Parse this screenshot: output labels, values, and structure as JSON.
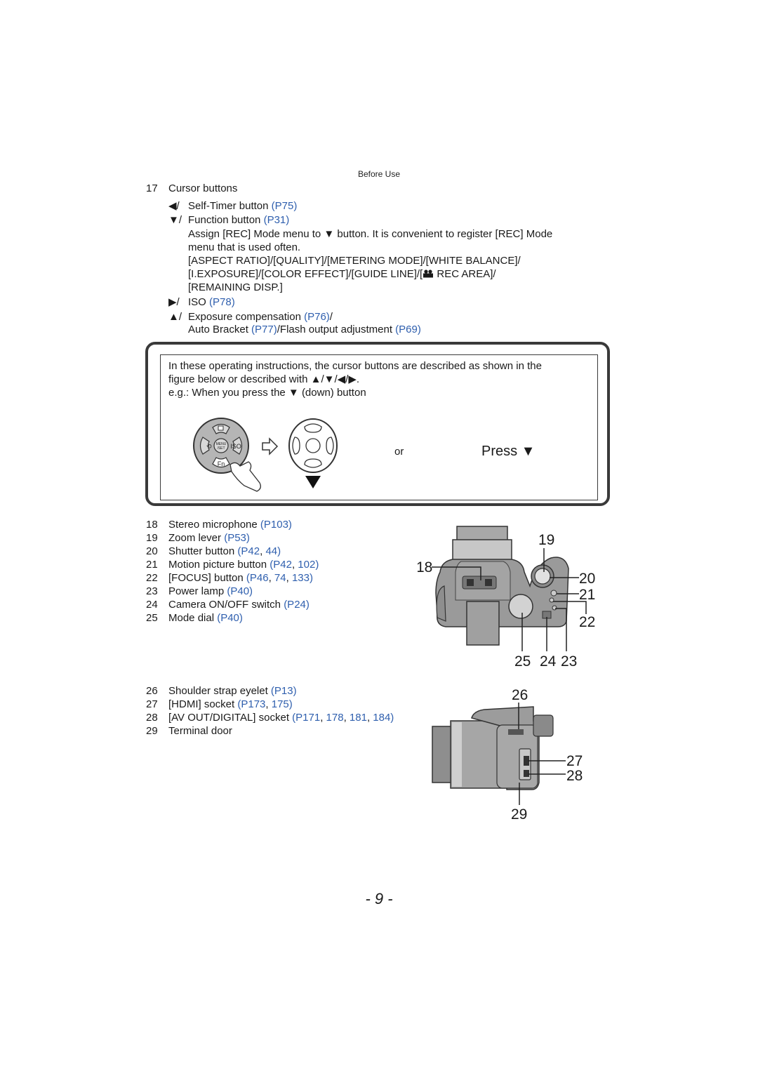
{
  "header": {
    "section": "Before Use"
  },
  "item17": {
    "number": "17",
    "title": "Cursor buttons",
    "entries": [
      {
        "arrow": "◀/",
        "label": "Self-Timer button ",
        "ref": "(P75)"
      },
      {
        "arrow": "▼/",
        "label": "Function button ",
        "ref": "(P31)"
      }
    ],
    "function_desc_line1": "Assign [REC] Mode menu to ▼ button. It is convenient to register [REC] Mode",
    "function_desc_line2": "menu that is used often.",
    "menu_items_line1": "[ASPECT RATIO]/[QUALITY]/[METERING MODE]/[WHITE BALANCE]/",
    "menu_items_line2_a": "[I.EXPOSURE]/[COLOR EFFECT]/[GUIDE LINE]/[",
    "menu_items_line2_icon": "motion-picture-icon",
    "menu_items_line2_b": " REC AREA]/",
    "menu_items_line3": "[REMAINING DISP.]",
    "iso": {
      "arrow": "▶/",
      "label": "ISO ",
      "ref": "(P78)"
    },
    "exposure": {
      "arrow": "▲/",
      "label": "Exposure compensation ",
      "ref": "(P76)",
      "suffix": "/"
    },
    "bracket": {
      "label1": "Auto Bracket ",
      "ref1": "(P77)",
      "label2": "/Flash output adjustment ",
      "ref2": "(P69)"
    }
  },
  "notebox": {
    "line1": "In these operating instructions, the cursor buttons are described as shown in the",
    "line2": "figure below or described with ▲/▼/◀/▶.",
    "line3": "e.g.: When you press the ▼ (down) button",
    "dial_labels": {
      "top": "☑",
      "left": "⟲",
      "center_1": "MENU",
      "center_2": "/SET",
      "right": "ISO",
      "bottom": "Fn"
    },
    "or_label": "or",
    "press_label": "Press ▼"
  },
  "items_top": [
    {
      "num": "18",
      "label": "Stereo microphone ",
      "refs": [
        "(P103)"
      ]
    },
    {
      "num": "19",
      "label": "Zoom lever ",
      "refs": [
        "(P53)"
      ]
    },
    {
      "num": "20",
      "label": "Shutter button ",
      "refs": [
        "(P42",
        "44)"
      ]
    },
    {
      "num": "21",
      "label": "Motion picture button ",
      "refs": [
        "(P42",
        "102)"
      ]
    },
    {
      "num": "22",
      "label": "[FOCUS] button ",
      "refs": [
        "(P46",
        "74",
        "133)"
      ]
    },
    {
      "num": "23",
      "label": "Power lamp ",
      "refs": [
        "(P40)"
      ]
    },
    {
      "num": "24",
      "label": "Camera ON/OFF switch ",
      "refs": [
        "(P24)"
      ]
    },
    {
      "num": "25",
      "label": "Mode dial ",
      "refs": [
        "(P40)"
      ]
    }
  ],
  "items_side": [
    {
      "num": "26",
      "label": "Shoulder strap eyelet ",
      "refs": [
        "(P13)"
      ]
    },
    {
      "num": "27",
      "label": "[HDMI] socket ",
      "refs": [
        "(P173",
        "175)"
      ]
    },
    {
      "num": "28",
      "label": "[AV OUT/DIGITAL] socket ",
      "refs": [
        "(P171",
        "178",
        "181",
        "184)"
      ]
    },
    {
      "num": "29",
      "label": "Terminal door",
      "refs": []
    }
  ],
  "top_callouts": {
    "c18": "18",
    "c19": "19",
    "c20": "20",
    "c21": "21",
    "c22": "22",
    "c23": "23",
    "c24": "24",
    "c25": "25"
  },
  "side_callouts": {
    "c26": "26",
    "c27": "27",
    "c28": "28",
    "c29": "29"
  },
  "colors": {
    "link": "#2f5fae",
    "text": "#1a1a1a",
    "camera_body": "#9a9a9a"
  },
  "page_number": "- 9 -"
}
